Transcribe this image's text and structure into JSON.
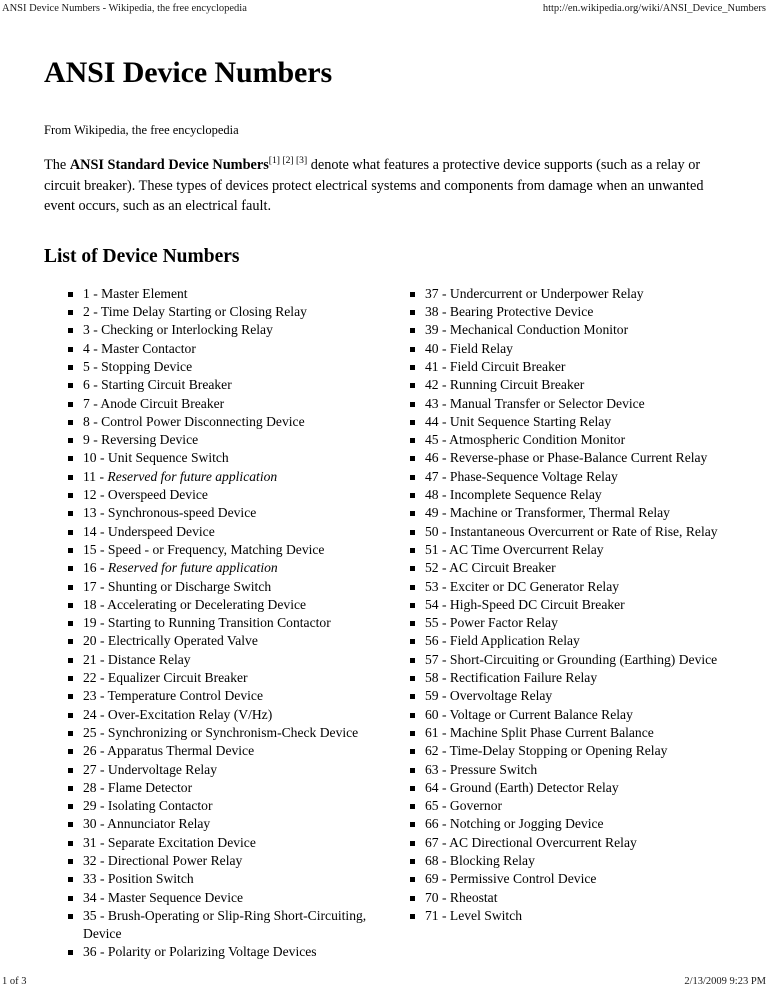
{
  "print_header": {
    "title": "ANSI Device Numbers - Wikipedia, the free encyclopedia",
    "url": "http://en.wikipedia.org/wiki/ANSI_Device_Numbers"
  },
  "article": {
    "title": "ANSI Device Numbers",
    "from_line": "From Wikipedia, the free encyclopedia",
    "lead": {
      "prefix": "The ",
      "bold_term": "ANSI Standard Device Numbers",
      "references": "[1] [2] [3]",
      "rest": " denote what features a protective device supports (such as a relay or circuit breaker). These types of devices protect electrical systems and components from damage when an unwanted event occurs, such as an electrical fault."
    },
    "section_title": "List of Device Numbers"
  },
  "device_list": {
    "left_column": [
      {
        "number": "1",
        "text": "Master Element",
        "italic": false
      },
      {
        "number": "2",
        "text": "Time Delay Starting or Closing Relay",
        "italic": false
      },
      {
        "number": "3",
        "text": "Checking or Interlocking Relay",
        "italic": false
      },
      {
        "number": "4",
        "text": "Master Contactor",
        "italic": false
      },
      {
        "number": "5",
        "text": "Stopping Device",
        "italic": false
      },
      {
        "number": "6",
        "text": "Starting Circuit Breaker",
        "italic": false
      },
      {
        "number": "7",
        "text": "Anode Circuit Breaker",
        "italic": false
      },
      {
        "number": "8",
        "text": "Control Power Disconnecting Device",
        "italic": false
      },
      {
        "number": "9",
        "text": "Reversing Device",
        "italic": false
      },
      {
        "number": "10",
        "text": "Unit Sequence Switch",
        "italic": false
      },
      {
        "number": "11",
        "text": "Reserved for future application",
        "italic": true
      },
      {
        "number": "12",
        "text": "Overspeed Device",
        "italic": false
      },
      {
        "number": "13",
        "text": "Synchronous-speed Device",
        "italic": false
      },
      {
        "number": "14",
        "text": "Underspeed Device",
        "italic": false
      },
      {
        "number": "15",
        "text": "Speed - or Frequency, Matching Device",
        "italic": false
      },
      {
        "number": "16",
        "text": "Reserved for future application",
        "italic": true
      },
      {
        "number": "17",
        "text": "Shunting or Discharge Switch",
        "italic": false
      },
      {
        "number": "18",
        "text": "Accelerating or Decelerating Device",
        "italic": false
      },
      {
        "number": "19",
        "text": "Starting to Running Transition Contactor",
        "italic": false
      },
      {
        "number": "20",
        "text": "Electrically Operated Valve",
        "italic": false
      },
      {
        "number": "21",
        "text": "Distance Relay",
        "italic": false
      },
      {
        "number": "22",
        "text": "Equalizer Circuit Breaker",
        "italic": false
      },
      {
        "number": "23",
        "text": "Temperature Control Device",
        "italic": false
      },
      {
        "number": "24",
        "text": "Over-Excitation Relay (V/Hz)",
        "italic": false
      },
      {
        "number": "25",
        "text": "Synchronizing or Synchronism-Check Device",
        "italic": false
      },
      {
        "number": "26",
        "text": "Apparatus Thermal Device",
        "italic": false
      },
      {
        "number": "27",
        "text": "Undervoltage Relay",
        "italic": false
      },
      {
        "number": "28",
        "text": "Flame Detector",
        "italic": false
      },
      {
        "number": "29",
        "text": "Isolating Contactor",
        "italic": false
      },
      {
        "number": "30",
        "text": "Annunciator Relay",
        "italic": false
      },
      {
        "number": "31",
        "text": "Separate Excitation Device",
        "italic": false
      },
      {
        "number": "32",
        "text": "Directional Power Relay",
        "italic": false
      },
      {
        "number": "33",
        "text": "Position Switch",
        "italic": false
      },
      {
        "number": "34",
        "text": "Master Sequence Device",
        "italic": false
      },
      {
        "number": "35",
        "text": "Brush-Operating or Slip-Ring Short-Circuiting, Device",
        "italic": false
      },
      {
        "number": "36",
        "text": "Polarity or Polarizing Voltage Devices",
        "italic": false
      }
    ],
    "right_column": [
      {
        "number": "37",
        "text": "Undercurrent or Underpower Relay",
        "italic": false
      },
      {
        "number": "38",
        "text": "Bearing Protective Device",
        "italic": false
      },
      {
        "number": "39",
        "text": "Mechanical Conduction Monitor",
        "italic": false
      },
      {
        "number": "40",
        "text": "Field Relay",
        "italic": false
      },
      {
        "number": "41",
        "text": "Field Circuit Breaker",
        "italic": false
      },
      {
        "number": "42",
        "text": "Running Circuit Breaker",
        "italic": false
      },
      {
        "number": "43",
        "text": "Manual Transfer or Selector Device",
        "italic": false
      },
      {
        "number": "44",
        "text": "Unit Sequence Starting Relay",
        "italic": false
      },
      {
        "number": "45",
        "text": "Atmospheric Condition Monitor",
        "italic": false
      },
      {
        "number": "46",
        "text": "Reverse-phase or Phase-Balance Current Relay",
        "italic": false
      },
      {
        "number": "47",
        "text": "Phase-Sequence Voltage Relay",
        "italic": false
      },
      {
        "number": "48",
        "text": "Incomplete Sequence Relay",
        "italic": false
      },
      {
        "number": "49",
        "text": "Machine or Transformer, Thermal Relay",
        "italic": false
      },
      {
        "number": "50",
        "text": "Instantaneous Overcurrent or Rate of Rise, Relay",
        "italic": false
      },
      {
        "number": "51",
        "text": "AC Time Overcurrent Relay",
        "italic": false
      },
      {
        "number": "52",
        "text": "AC Circuit Breaker",
        "italic": false
      },
      {
        "number": "53",
        "text": "Exciter or DC Generator Relay",
        "italic": false
      },
      {
        "number": "54",
        "text": "High-Speed DC Circuit Breaker",
        "italic": false
      },
      {
        "number": "55",
        "text": "Power Factor Relay",
        "italic": false
      },
      {
        "number": "56",
        "text": "Field Application Relay",
        "italic": false
      },
      {
        "number": "57",
        "text": "Short-Circuiting or Grounding (Earthing) Device",
        "italic": false
      },
      {
        "number": "58",
        "text": "Rectification Failure Relay",
        "italic": false
      },
      {
        "number": "59",
        "text": "Overvoltage Relay",
        "italic": false
      },
      {
        "number": "60",
        "text": "Voltage or Current Balance Relay",
        "italic": false
      },
      {
        "number": "61",
        "text": "Machine Split Phase Current Balance",
        "italic": false
      },
      {
        "number": "62",
        "text": "Time-Delay Stopping or Opening Relay",
        "italic": false
      },
      {
        "number": "63",
        "text": "Pressure Switch",
        "italic": false
      },
      {
        "number": "64",
        "text": "Ground (Earth) Detector Relay",
        "italic": false
      },
      {
        "number": "65",
        "text": "Governor",
        "italic": false
      },
      {
        "number": "66",
        "text": "Notching or Jogging Device",
        "italic": false
      },
      {
        "number": "67",
        "text": "AC Directional Overcurrent Relay",
        "italic": false
      },
      {
        "number": "68",
        "text": "Blocking Relay",
        "italic": false
      },
      {
        "number": "69",
        "text": "Permissive Control Device",
        "italic": false
      },
      {
        "number": "70",
        "text": "Rheostat",
        "italic": false
      },
      {
        "number": "71",
        "text": "Level Switch",
        "italic": false
      }
    ],
    "separator": " - "
  },
  "print_footer": {
    "page_label": "1 of 3",
    "timestamp": "2/13/2009 9:23 PM"
  }
}
